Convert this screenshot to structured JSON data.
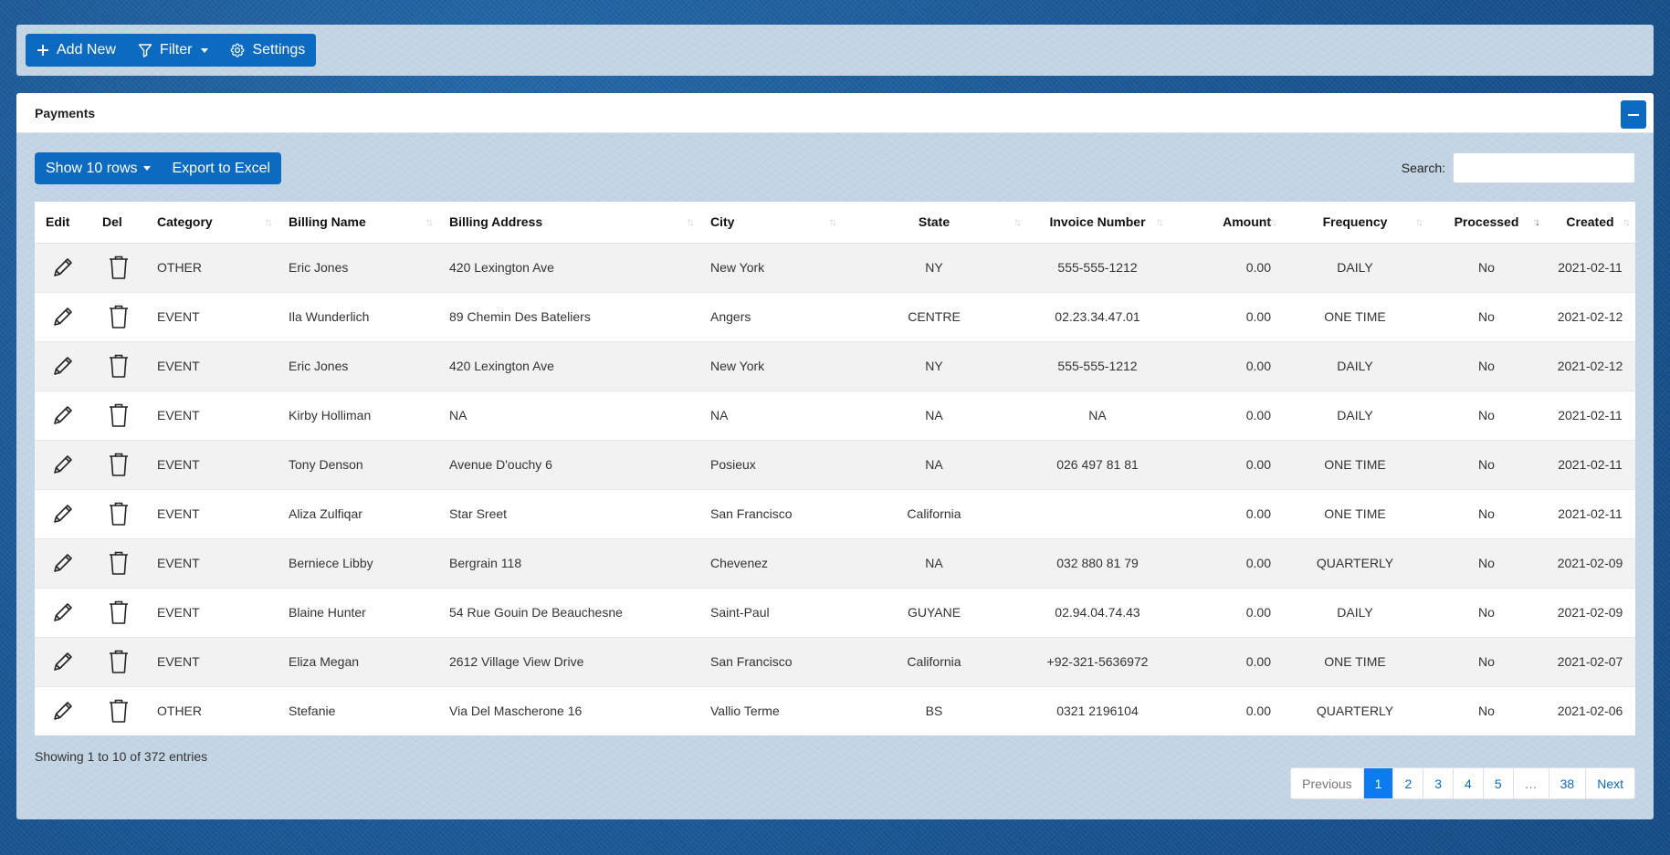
{
  "toolbar": {
    "add_new": "Add New",
    "filter": "Filter",
    "settings": "Settings"
  },
  "card": {
    "title": "Payments"
  },
  "table_controls": {
    "show_rows": "Show 10 rows",
    "export": "Export to Excel",
    "search_label": "Search:",
    "search_value": ""
  },
  "table": {
    "columns": [
      "Edit",
      "Del",
      "Category",
      "Billing Name",
      "Billing Address",
      "City",
      "State",
      "Invoice Number",
      "Amount",
      "Frequency",
      "Processed",
      "Created"
    ],
    "rows": [
      [
        "OTHER",
        "Eric Jones",
        "420 Lexington Ave",
        "New York",
        "NY",
        "555-555-1212",
        "0.00",
        "DAILY",
        "No",
        "2021-02-11"
      ],
      [
        "EVENT",
        "Ila Wunderlich",
        "89 Chemin Des Bateliers",
        "Angers",
        "CENTRE",
        "02.23.34.47.01",
        "0.00",
        "ONE TIME",
        "No",
        "2021-02-12"
      ],
      [
        "EVENT",
        "Eric Jones",
        "420 Lexington Ave",
        "New York",
        "NY",
        "555-555-1212",
        "0.00",
        "DAILY",
        "No",
        "2021-02-12"
      ],
      [
        "EVENT",
        "Kirby Holliman",
        "NA",
        "NA",
        "NA",
        "NA",
        "0.00",
        "DAILY",
        "No",
        "2021-02-11"
      ],
      [
        "EVENT",
        "Tony Denson",
        "Avenue D'ouchy 6",
        "Posieux",
        "NA",
        "026 497 81 81",
        "0.00",
        "ONE TIME",
        "No",
        "2021-02-11"
      ],
      [
        "EVENT",
        "Aliza Zulfiqar",
        "Star Sreet",
        "San Francisco",
        "California",
        "",
        "0.00",
        "ONE TIME",
        "No",
        "2021-02-11"
      ],
      [
        "EVENT",
        "Berniece Libby",
        "Bergrain 118",
        "Chevenez",
        "NA",
        "032 880 81 79",
        "0.00",
        "QUARTERLY",
        "No",
        "2021-02-09"
      ],
      [
        "EVENT",
        "Blaine Hunter",
        "54 Rue Gouin De Beauchesne",
        "Saint-Paul",
        "GUYANE",
        "02.94.04.74.43",
        "0.00",
        "DAILY",
        "No",
        "2021-02-09"
      ],
      [
        "EVENT",
        "Eliza Megan",
        "2612 Village View Drive",
        "San Francisco",
        "California",
        "+92-321-5636972",
        "0.00",
        "ONE TIME",
        "No",
        "2021-02-07"
      ],
      [
        "OTHER",
        "Stefanie",
        "Via Del Mascherone 16",
        "Vallio Terme",
        "BS",
        "0321 2196104",
        "0.00",
        "QUARTERLY",
        "No",
        "2021-02-06"
      ]
    ]
  },
  "footer": {
    "info": "Showing 1 to 10 of 372 entries",
    "pagination": [
      "Previous",
      "1",
      "2",
      "3",
      "4",
      "5",
      "…",
      "38",
      "Next"
    ],
    "active_page": "1"
  },
  "colors": {
    "primary": "#0d6ac1",
    "active_page": "#0d7bf0"
  }
}
